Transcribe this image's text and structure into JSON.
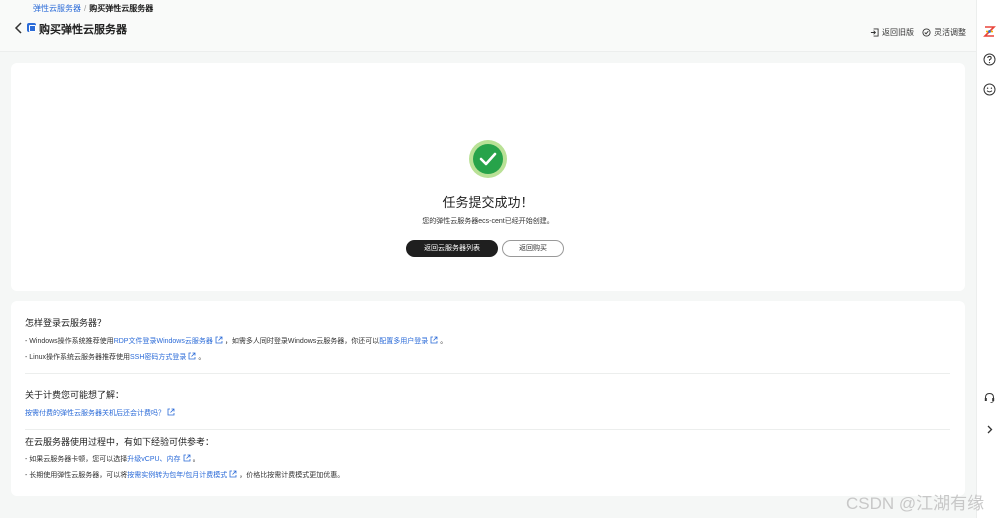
{
  "header": {
    "breadcrumb": {
      "parent": "弹性云服务器",
      "separator": "/",
      "current": "购买弹性云服务器"
    },
    "title": "购买弹性云服务器",
    "actions": {
      "old_version": "返回旧版",
      "flexible": "灵活调整"
    }
  },
  "success": {
    "title": "任务提交成功！",
    "desc": "您的弹性云服务器ecs-cent已经开始创建。",
    "btn_list": "返回云服务器列表",
    "btn_buy": "返回购买"
  },
  "help": {
    "login": {
      "title": "怎样登录云服务器？",
      "l1_a": "- Windows操作系统推荐使用",
      "l1_link1": "RDP文件登录Windows云服务器",
      "l1_b": "，如需多人同时登录Windows云服务器，你还可以",
      "l1_link2": "配置多用户登录",
      "l1_c": "。",
      "l2_a": "- Linux操作系统云服务器推荐使用",
      "l2_link": "SSH密码方式登录",
      "l2_b": "。"
    },
    "billing": {
      "title": "关于计费您可能想了解：",
      "link": "按需付费的弹性云服务器关机后还会计费吗？"
    },
    "tips": {
      "title": "在云服务器使用过程中，有如下经验可供参考：",
      "l1_a": "- 如果云服务器卡顿，您可以选择",
      "l1_link": "升级vCPU、内存",
      "l1_b": "。",
      "l2_a": "- 长期使用弹性云服务器，可以将",
      "l2_link": "按需实例转为包年/包月计费模式",
      "l2_b": "，价格比按需计费模式更加优惠。"
    }
  },
  "rail": {
    "icons": [
      "brand-logo-icon",
      "help-icon",
      "smiley-icon",
      "headset-icon",
      "chevron-right-icon"
    ]
  },
  "watermark": "CSDN @江湖有缘",
  "colors": {
    "accent": "#2b6bd8",
    "success": "#27a34a",
    "success_ring": "#b9e196",
    "primary_button": "#1f1f1f"
  }
}
